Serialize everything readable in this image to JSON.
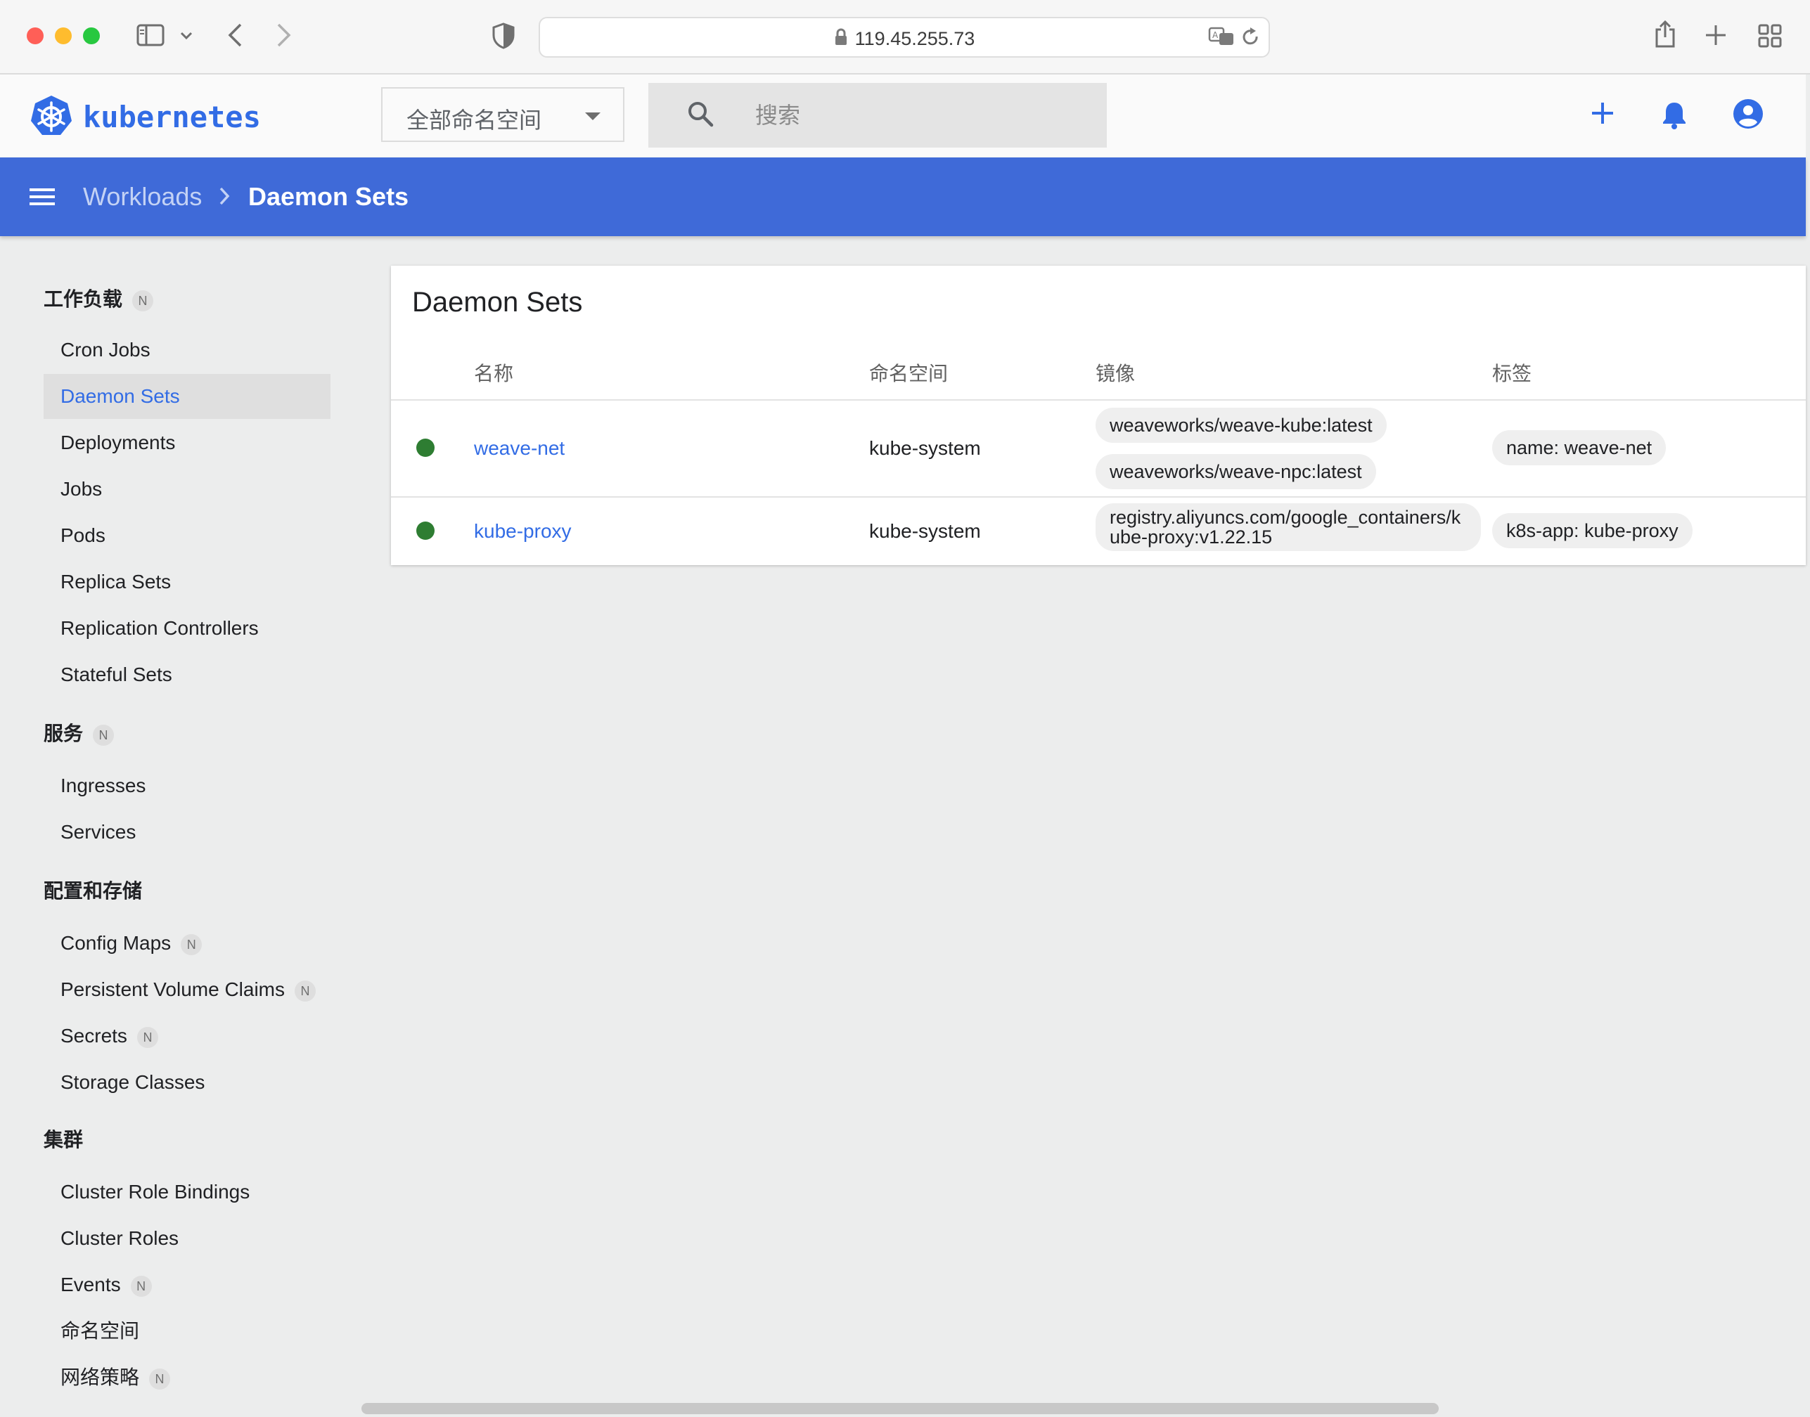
{
  "browser": {
    "address": "119.45.255.73"
  },
  "header": {
    "brand": "kubernetes",
    "namespace_select": "全部命名空间",
    "search_placeholder": "搜索"
  },
  "breadcrumb": {
    "parent": "Workloads",
    "current": "Daemon Sets"
  },
  "sidebar": {
    "sections": [
      {
        "title": "工作负载",
        "badge": "N",
        "items": [
          {
            "label": "Cron Jobs"
          },
          {
            "label": "Daemon Sets",
            "active": true
          },
          {
            "label": "Deployments"
          },
          {
            "label": "Jobs"
          },
          {
            "label": "Pods"
          },
          {
            "label": "Replica Sets"
          },
          {
            "label": "Replication Controllers"
          },
          {
            "label": "Stateful Sets"
          }
        ]
      },
      {
        "title": "服务",
        "badge": "N",
        "items": [
          {
            "label": "Ingresses"
          },
          {
            "label": "Services"
          }
        ]
      },
      {
        "title": "配置和存储",
        "items": [
          {
            "label": "Config Maps",
            "badge": "N"
          },
          {
            "label": "Persistent Volume Claims",
            "badge": "N"
          },
          {
            "label": "Secrets",
            "badge": "N"
          },
          {
            "label": "Storage Classes"
          }
        ]
      },
      {
        "title": "集群",
        "items": [
          {
            "label": "Cluster Role Bindings"
          },
          {
            "label": "Cluster Roles"
          },
          {
            "label": "Events",
            "badge": "N"
          },
          {
            "label": "命名空间"
          },
          {
            "label": "网络策略",
            "badge": "N"
          }
        ]
      }
    ]
  },
  "main": {
    "title": "Daemon Sets",
    "columns": {
      "name": "名称",
      "namespace": "命名空间",
      "images": "镜像",
      "labels": "标签"
    },
    "rows": [
      {
        "status": "running",
        "name": "weave-net",
        "namespace": "kube-system",
        "images": [
          "weaveworks/weave-kube:latest",
          "weaveworks/weave-npc:latest"
        ],
        "labels": [
          "name: weave-net"
        ]
      },
      {
        "status": "running",
        "name": "kube-proxy",
        "namespace": "kube-system",
        "images": [
          "registry.aliyuncs.com/google_containers/kube-proxy:v1.22.15"
        ],
        "labels": [
          "k8s-app: kube-proxy"
        ]
      }
    ]
  },
  "colors": {
    "accent": "#326ce5",
    "toolbar": "#3f6ad8",
    "status_running": "#2e7d32"
  }
}
